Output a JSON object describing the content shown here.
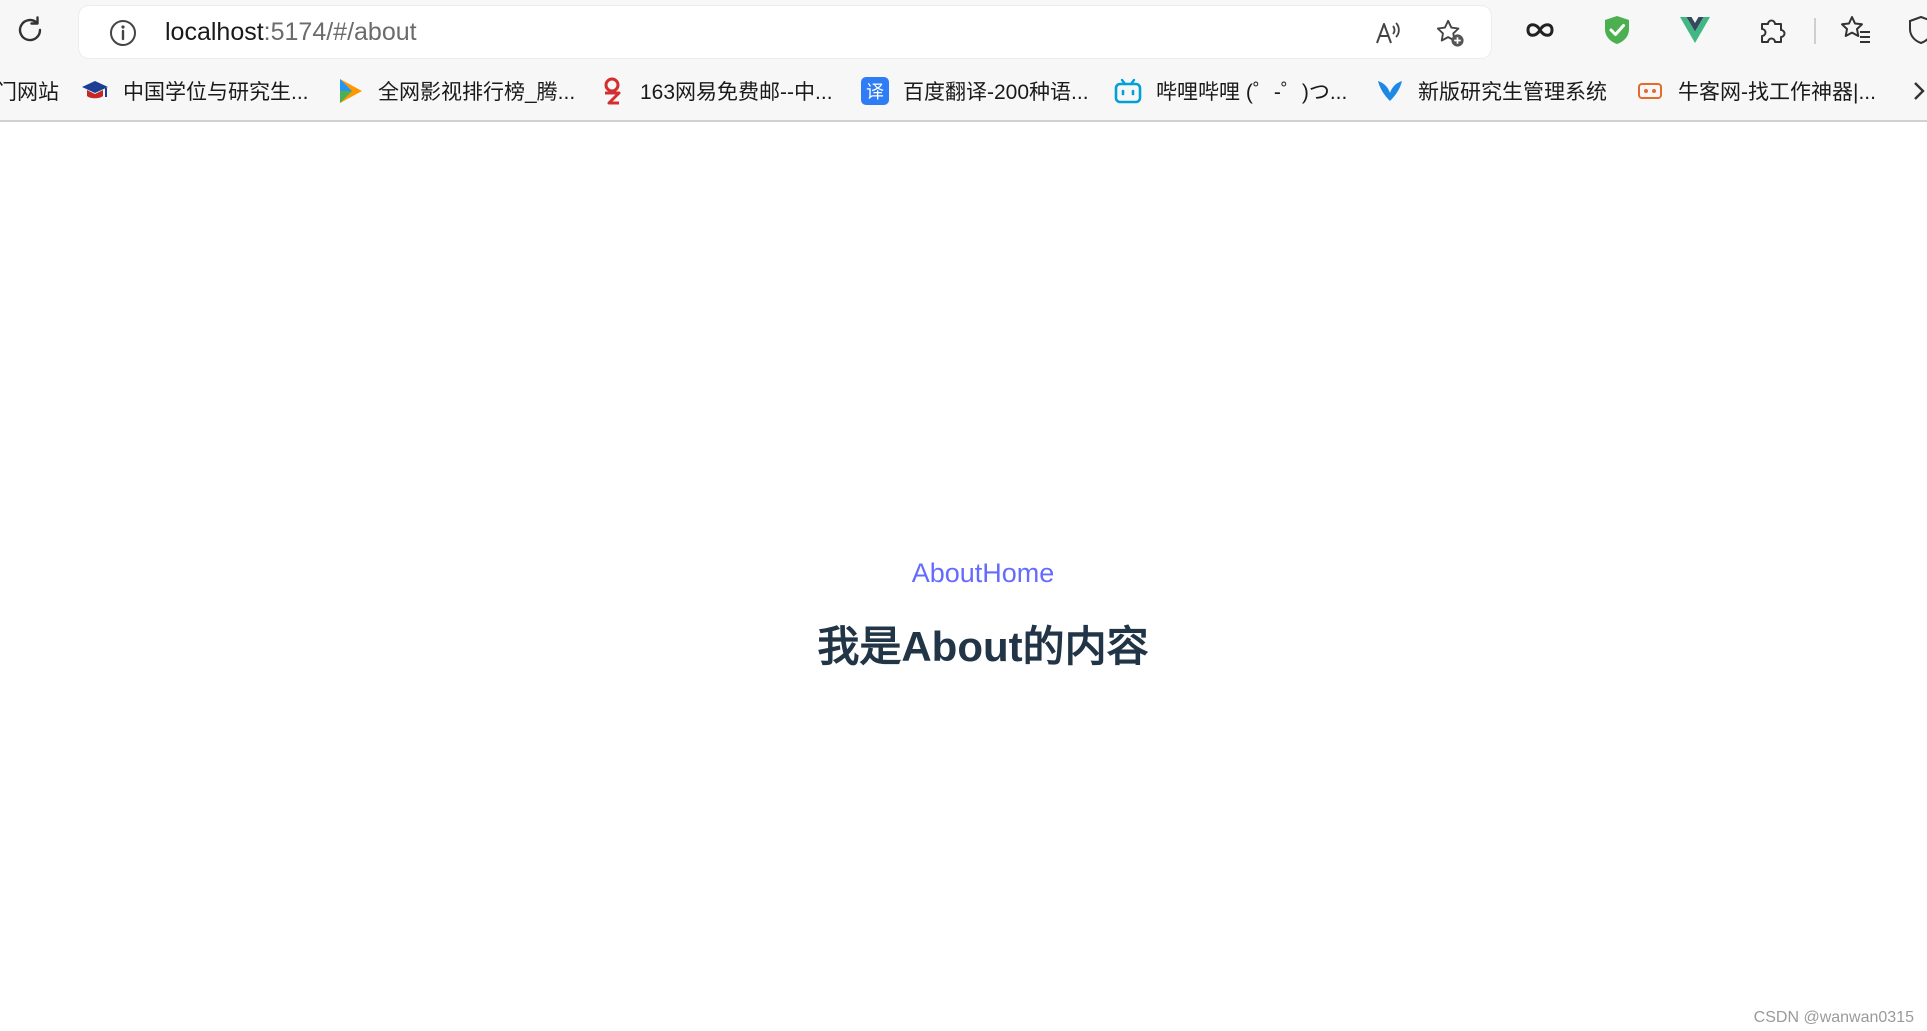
{
  "address_bar": {
    "host": "localhost",
    "path": ":5174/#/about"
  },
  "bookmarks": [
    {
      "label": "门网站"
    },
    {
      "label": "中国学位与研究生..."
    },
    {
      "label": "全网影视排行榜_腾..."
    },
    {
      "label": "163网易免费邮--中..."
    },
    {
      "label": "百度翻译-200种语..."
    },
    {
      "label": "哔哩哔哩 (゜-゜)つ..."
    },
    {
      "label": "新版研究生管理系统"
    },
    {
      "label": "牛客网-找工作神器|..."
    }
  ],
  "page": {
    "nav_about": "About",
    "nav_home": "Home",
    "heading": "我是About的内容"
  },
  "watermark": "CSDN @wanwan0315",
  "colors": {
    "link": "#646cff",
    "heading": "#213547",
    "shield": "#4caf50",
    "vue_green": "#41b883",
    "vue_dark": "#34495e"
  },
  "icons": {
    "refresh": "refresh-icon",
    "site_info": "info-icon",
    "read_aloud": "read-aloud-icon",
    "add_favorite": "add-favorite-icon",
    "infinity": "infinity-icon",
    "shield": "shield-check-icon",
    "vue_devtools": "vue-logo-icon",
    "extensions": "puzzle-icon",
    "favorites": "favorites-icon"
  }
}
